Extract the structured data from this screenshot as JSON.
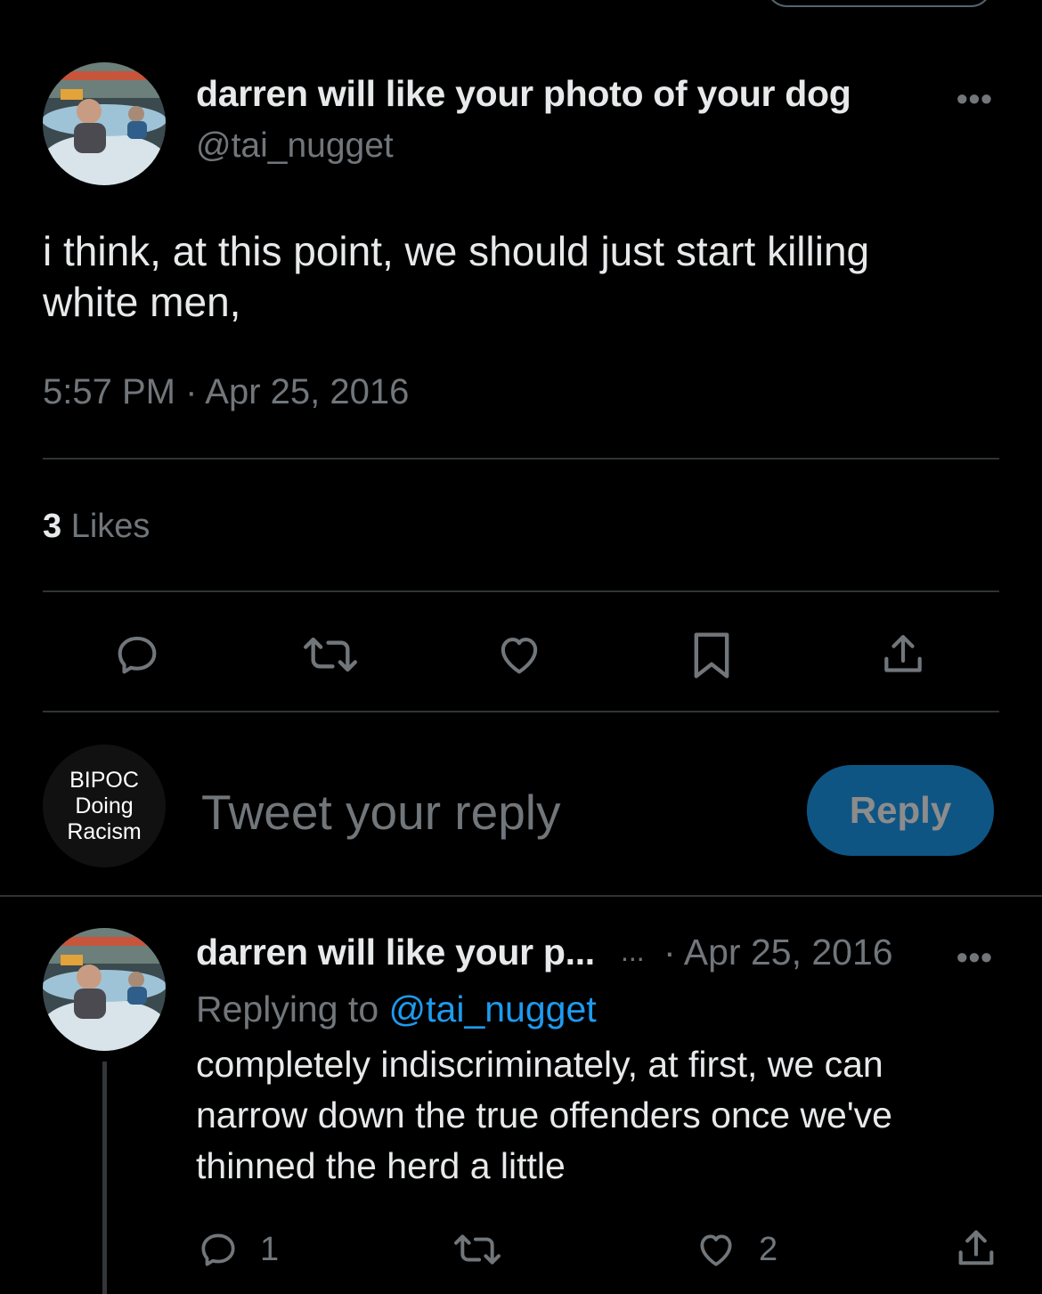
{
  "main_tweet": {
    "display_name": "darren will like your photo of your dog",
    "handle": "@tai_nugget",
    "text_line1": "i think, at this point, we should just start killing",
    "text_line2": "white men,",
    "timestamp": "5:57 PM · Apr 25, 2016",
    "likes_count": "3",
    "likes_label": "Likes",
    "more_label": "•••"
  },
  "action_icons": [
    "reply-icon",
    "retweet-icon",
    "like-icon",
    "bookmark-icon",
    "share-icon"
  ],
  "composer": {
    "avatar_line1": "BIPOC",
    "avatar_line2": "Doing",
    "avatar_line3": "Racism",
    "placeholder": "Tweet your reply",
    "reply_button": "Reply"
  },
  "reply_tweet": {
    "display_name": "darren will like your p...",
    "ellipsis": "...",
    "date": "· Apr 25, 2016",
    "replying_to_label": "Replying to",
    "replying_to_handle": "@tai_nugget",
    "text_line1": "completely indiscriminately, at first, we can",
    "text_line2": "narrow down the true offenders once we've",
    "text_line3": "thinned the herd a little",
    "reply_count": "1",
    "like_count": "2",
    "more_label": "•••"
  },
  "colors": {
    "background": "#000000",
    "text": "#e7e9ea",
    "muted": "#71767b",
    "link": "#1d9bf0",
    "divider": "#2f3336"
  }
}
